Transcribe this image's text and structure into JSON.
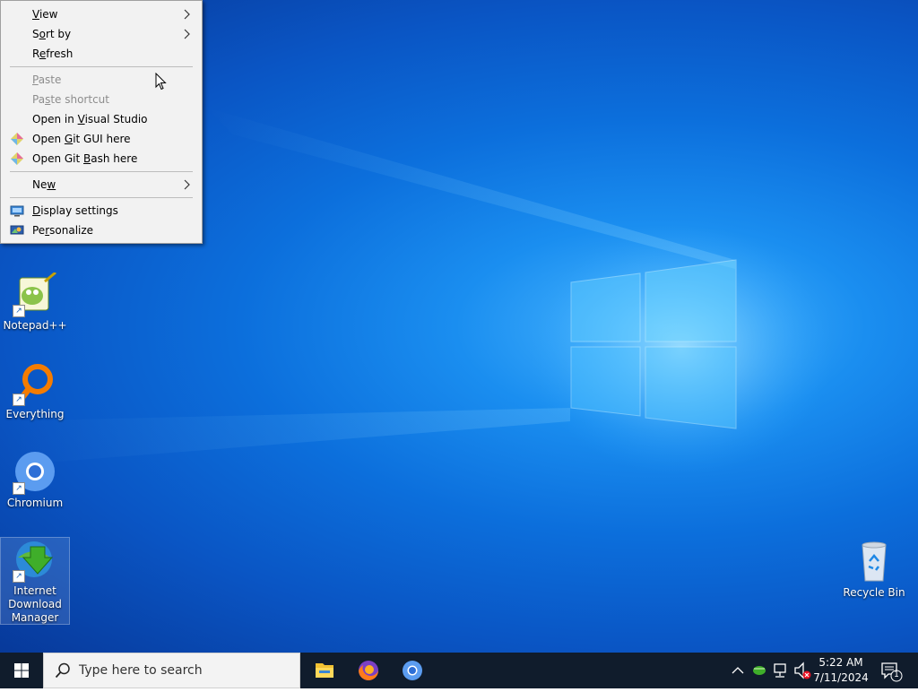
{
  "context_menu": {
    "items": [
      {
        "label": "View",
        "underline": "V",
        "has_submenu": true,
        "disabled": false
      },
      {
        "label": "Sort by",
        "underline": "o",
        "has_submenu": true,
        "disabled": false
      },
      {
        "label": "Refresh",
        "underline": "e",
        "has_submenu": false,
        "disabled": false
      },
      {
        "label": "Paste",
        "underline": "P",
        "has_submenu": false,
        "disabled": true
      },
      {
        "label": "Paste shortcut",
        "underline": "s",
        "has_submenu": false,
        "disabled": true
      },
      {
        "label": "Open in Visual Studio",
        "underline": "V",
        "has_submenu": false,
        "disabled": false
      },
      {
        "label": "Open Git GUI here",
        "underline": "G",
        "has_submenu": false,
        "disabled": false,
        "icon": "git-icon"
      },
      {
        "label": "Open Git Bash here",
        "underline": "B",
        "has_submenu": false,
        "disabled": false,
        "icon": "git-icon"
      },
      {
        "label": "New",
        "underline": "w",
        "has_submenu": true,
        "disabled": false
      },
      {
        "label": "Display settings",
        "underline": "D",
        "has_submenu": false,
        "disabled": false,
        "icon": "display-icon"
      },
      {
        "label": "Personalize",
        "underline": "r",
        "has_submenu": false,
        "disabled": false,
        "icon": "personalize-icon"
      }
    ]
  },
  "desktop": {
    "icons": [
      {
        "label": "Notepad++",
        "icon": "notepadpp-icon",
        "shortcut": true
      },
      {
        "label": "Everything",
        "icon": "everything-icon",
        "shortcut": true
      },
      {
        "label": "Chromium",
        "icon": "chromium-icon",
        "shortcut": true
      },
      {
        "label": "Internet Download Manager",
        "icon": "idm-icon",
        "shortcut": true,
        "selected": true
      },
      {
        "label": "Recycle Bin",
        "icon": "recycle-bin-icon",
        "shortcut": false
      }
    ]
  },
  "taskbar": {
    "search_placeholder": "Type here to search",
    "pinned": [
      "file-explorer-icon",
      "firefox-icon",
      "chromium-icon"
    ],
    "tray_icons": [
      "chevron-up-icon",
      "network-app-icon",
      "network-icon",
      "volume-muted-icon"
    ],
    "clock": {
      "time": "5:22 AM",
      "date": "7/11/2024"
    },
    "notifications_count": "1"
  },
  "colors": {
    "taskbar": "#101c2c",
    "menu_bg": "#f2f2f2",
    "desktop_accent": "#1a8ef0"
  }
}
